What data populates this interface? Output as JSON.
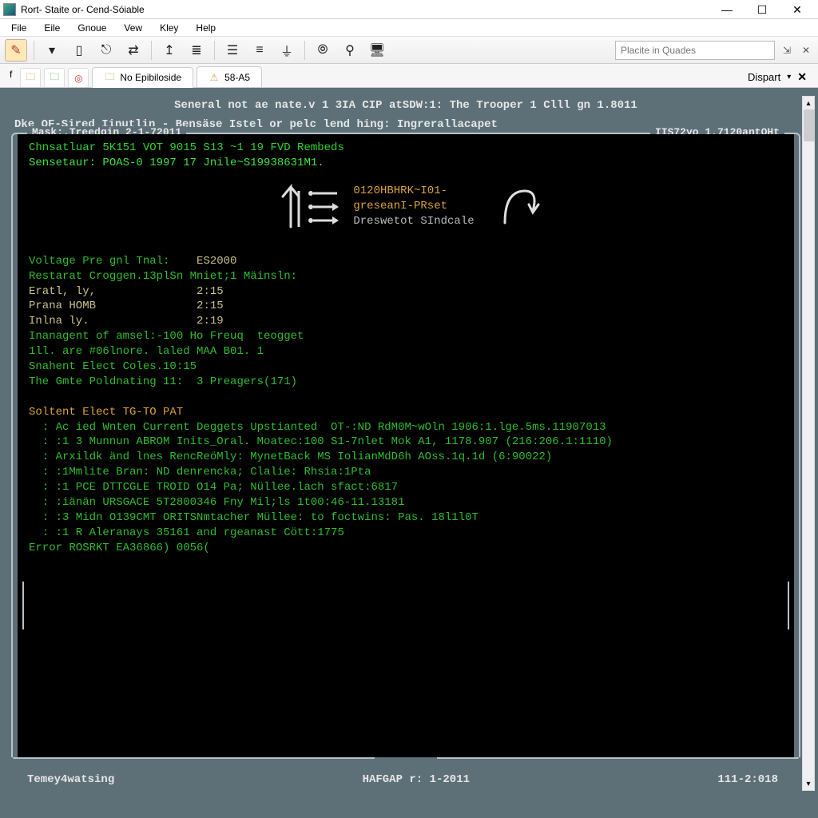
{
  "window": {
    "title": "Rort- Staite or- Cend-Sóiable"
  },
  "menu": {
    "items": [
      "File",
      "Eile",
      "Gnoue",
      "Vew",
      "Kley",
      "Help"
    ]
  },
  "toolbar": {
    "search_placeholder": "Placite in Quades",
    "icons": [
      "tool-paint",
      "tool-eye",
      "tool-caret",
      "tool-lamp",
      "tool-branch",
      "tool-share",
      "tool-up",
      "tool-lines",
      "tool-align-l",
      "tool-align-c",
      "tool-weight",
      "tool-zoom",
      "tool-pin",
      "tool-monitor"
    ]
  },
  "tabs": {
    "prefix": "f",
    "items": [
      {
        "icon": "folder-orange-icon",
        "label": ""
      },
      {
        "icon": "folder-green-icon",
        "label": ""
      },
      {
        "icon": "target-red-icon",
        "label": ""
      },
      {
        "icon": "folder-icon",
        "label": "No Epibiloside"
      },
      {
        "icon": "warn-icon",
        "label": "58-A5"
      }
    ],
    "right": {
      "label": "Dispart"
    }
  },
  "console": {
    "title_line": "Seneral not ae nate.v 1 3IA CIP atSDW:1: The Trooper 1 Clll gn 1.8011",
    "subheader": "Dke OF-Sired Iinutlin  -  Bensäse Istel or pelc lend hing: Ingrerallacapet",
    "mask_label": "Mask:.Treedgin 2-1-72011",
    "right_label": "IIS72yo 1.7120antOHt",
    "lines_top": [
      "Chnsatluar 5K151 VOT 9015 S13 ~1 19 FVD Rembeds",
      "Sensetaur: POAS-0 1997 17 Jnile~S19938631M1."
    ],
    "diagram": {
      "label1": "0120HBHRK~I01-",
      "label2": "greseanI-PRset",
      "label3": "Dreswetot SIndcale"
    },
    "section1": [
      [
        "Voltage Pre gnl Tnal:",
        "ES2000"
      ],
      [
        "Restarat Croggen.13plSn Mniet;",
        "1 Mäinsln:"
      ],
      [
        "Eratl, ly,",
        "2:15"
      ],
      [
        "Prana HOMB",
        "2:15"
      ],
      [
        "Inlna ly.",
        "2:19"
      ]
    ],
    "section1_raw": [
      "Inanagent of amsel:-100 Ho Freuq  teogget",
      "1ll. are #06lnore. laled MAA B01. 1",
      "Snahent Elect Coles.10:15",
      "The Gmte Poldnating 11:  3 Preagers(171)"
    ],
    "section2_title": "Soltent Elect TG-TO PAT",
    "section2": [
      ": Ac ied Wnten Current Deggets Upstianted  OT-:ND RdM0M~wOln 1906:1.lge.5ms.11907013",
      ": :1 3 Munnun ABROM Inits_Oral. Moatec:100 S1-7nlet Mok A1, 1178.907 (216:206.1:1110)",
      ": Arxildk änd lnes RencReöMly: MynetBack MS IolianMdD6h AOss.1q.1d (6:90022)",
      ": :1Mmlite Bran: ND denrencka; Clalie: Rhsia:1Pta",
      ": :1 PCE DTTCGLE TROID O14 Pa; Nüllee.lach sfact:6817",
      ": :iänän URSGACE 5T2800346 Fny Mil;ls 1t00:46-11.13181",
      ": :3 Midn O139CMT ORITSNmtacher Müllee: to foctwins: Pas. 18l1l0T",
      ": :1 R Aleranays 35161 and rgeanast Cött:1775"
    ],
    "error_line": "Error ROSRKT EA36866) 0056(",
    "footer": {
      "left": "Temey4watsing",
      "mid": "HAFGAP r: 1-2011",
      "right": "111-2:018"
    }
  }
}
